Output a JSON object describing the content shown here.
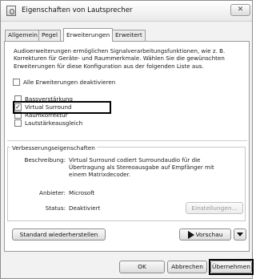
{
  "window": {
    "title": "Eigenschaften von Lautsprecher",
    "close_glyph": "✕"
  },
  "tabs": [
    {
      "label": "Allgemein"
    },
    {
      "label": "Pegel"
    },
    {
      "label": "Erweiterungen",
      "active": true
    },
    {
      "label": "Erweitert"
    }
  ],
  "enhancements": {
    "description": "Audioerweiterungen ermöglichen Signalverarbeitungsfunktionen, wie z. B. Korrekturen für Geräte- und Raummerkmale. Wählen Sie die gewünschten Erweiterungen für diese Konfiguration aus der folgenden Liste aus.",
    "disable_all_label": "Alle Erweiterungen deaktivieren",
    "disable_all_checked": false,
    "items": [
      {
        "label": "Bassverstärkung",
        "checked": false
      },
      {
        "label": "Virtual Surround",
        "checked": true
      },
      {
        "label": "Raumkorrektur",
        "checked": false
      },
      {
        "label": "Lautstärkeausgleich",
        "checked": false
      }
    ]
  },
  "properties": {
    "group_label": "Verbesserungseigenschaften",
    "description_key": "Beschreibung:",
    "description_value": "Virtual Surround codiert Surroundaudio für die Übertragung als Stereoausgabe auf Empfänger mit einem Matrixdecoder.",
    "provider_key": "Anbieter:",
    "provider_value": "Microsoft",
    "status_key": "Status:",
    "status_value": "Deaktiviert",
    "settings_button": "Einstellungen..."
  },
  "bottom": {
    "restore_defaults": "Standard wiederherstellen",
    "preview": "Vorschau"
  },
  "footer": {
    "ok": "OK",
    "cancel": "Abbrechen",
    "apply": "Übernehmen"
  },
  "colors": {
    "highlight_border": "#000000",
    "window_background": "#f2f2f2"
  }
}
